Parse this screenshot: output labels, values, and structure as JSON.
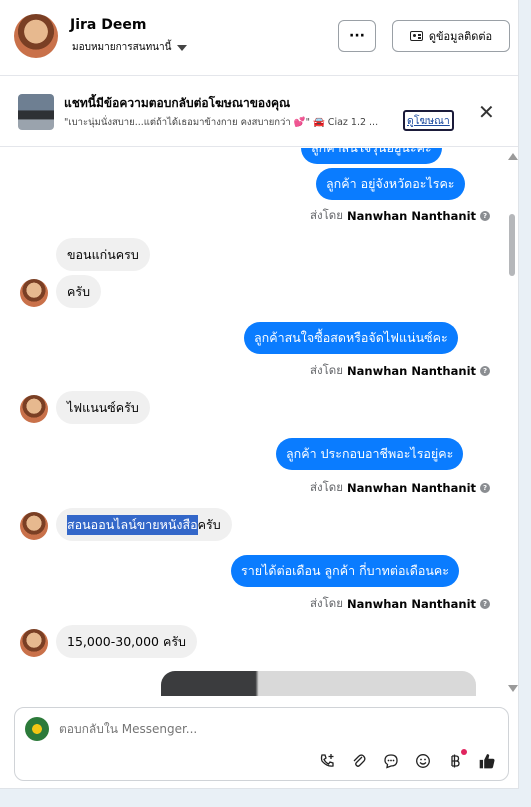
{
  "header": {
    "contact_name": "Jira Deem",
    "status": "มอบหมายการสนทนานี้",
    "more_label": "···",
    "contact_info_label": "ดูข้อมูลติดต่อ"
  },
  "ad_banner": {
    "title": "แชทนี้มีข้อความตอบกลับต่อโฆษณาของคุณ",
    "snippet": "\"เบาะนุ่มนั่งสบาย...แต่ถ้าได้เธอมาข้างกาย คงสบายกว่า 💕\" 🚘 Ciaz 1.2 ...",
    "link_label": "ดูโฆษณา",
    "close_label": "✕"
  },
  "messages": [
    {
      "id": "m0",
      "type": "outgoing",
      "text": "ลูกค้าสนใจรุ่นอยู่นะคะ"
    },
    {
      "id": "m1",
      "type": "outgoing",
      "text": "ลูกค้า อยู่จังหวัดอะไรคะ"
    },
    {
      "id": "m1s",
      "type": "sent_by",
      "prefix": "ส่งโดย",
      "name": "Nanwhan Nanthanit"
    },
    {
      "id": "m2",
      "type": "incoming",
      "text": "ขอนแก่นครบ"
    },
    {
      "id": "m3",
      "type": "incoming",
      "text": "ครับ"
    },
    {
      "id": "m4",
      "type": "outgoing",
      "text": "ลูกค้าสนใจซื้อสดหรือจัดไฟแน่นซ์คะ"
    },
    {
      "id": "m4s",
      "type": "sent_by",
      "prefix": "ส่งโดย",
      "name": "Nanwhan Nanthanit"
    },
    {
      "id": "m5",
      "type": "incoming",
      "text": "ไฟแนนซ์ครับ"
    },
    {
      "id": "m6",
      "type": "outgoing",
      "text": "ลูกค้า ประกอบอาชีพอะไรอยู่คะ"
    },
    {
      "id": "m6s",
      "type": "sent_by",
      "prefix": "ส่งโดย",
      "name": "Nanwhan Nanthanit"
    },
    {
      "id": "m7",
      "type": "incoming",
      "text_highlighted": "สอนออนไลน์ขายหนังสือ",
      "text_rest": "ครับ"
    },
    {
      "id": "m8",
      "type": "outgoing",
      "text": "รายได้ต่อเดือน ลูกค้า กี่บาทต่อเดือนคะ"
    },
    {
      "id": "m8s",
      "type": "sent_by",
      "prefix": "ส่งโดย",
      "name": "Nanwhan Nanthanit"
    },
    {
      "id": "m9",
      "type": "incoming",
      "text": "15,000-30,000 ครับ"
    }
  ],
  "composer": {
    "placeholder": "ตอบกลับใน Messenger..."
  },
  "icons": {
    "more": "more-options-icon",
    "contact_card": "contact-card-icon",
    "close": "close-icon",
    "info": "info-icon",
    "call": "call-icon",
    "attach": "paperclip-icon",
    "saved_reply": "chat-bubble-icon",
    "emoji": "emoji-icon",
    "payment": "baht-icon",
    "like": "thumbs-up-icon"
  },
  "colors": {
    "accent": "#0a7cff",
    "incoming_bubble": "#f0f0f0"
  }
}
